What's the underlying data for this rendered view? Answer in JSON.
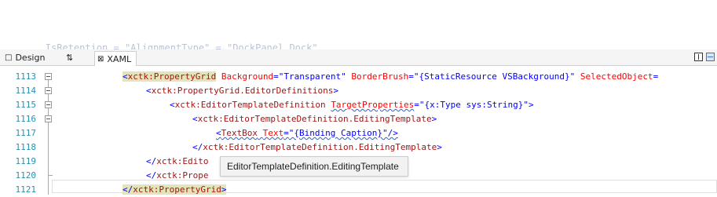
{
  "tabs": {
    "design": "Design",
    "swap_icon": "swap-panes-icon",
    "xaml": "XAML"
  },
  "editor": {
    "ghost_text": "        IsRetention = \"AlignmentType\" = \"DockPanel.Dock\"",
    "lines": [
      {
        "number": "1113"
      },
      {
        "number": "1114"
      },
      {
        "number": "1115"
      },
      {
        "number": "1116"
      },
      {
        "number": "1117"
      },
      {
        "number": "1118"
      },
      {
        "number": "1119"
      },
      {
        "number": "1120"
      },
      {
        "number": "1121"
      }
    ],
    "code": {
      "l1113": {
        "open": "<",
        "tag": "xctk:PropertyGrid",
        "a1": "Background",
        "v1": "\"Transparent\"",
        "a2": "BorderBrush",
        "v2": "\"{StaticResource VSBackground}\"",
        "a3": "SelectedObject",
        "eq": "="
      },
      "l1114": {
        "open": "<",
        "tag": "xctk:PropertyGrid.EditorDefinitions",
        "close": ">"
      },
      "l1115": {
        "open": "<",
        "tag": "xctk:EditorTemplateDefinition",
        "a1": "TargetProperties",
        "v1": "\"{x:Type sys:String}\"",
        "close": ">"
      },
      "l1116": {
        "open": "<",
        "tag": "xctk:EditorTemplateDefinition.EditingTemplate",
        "close": ">"
      },
      "l1117": {
        "open": "<",
        "tag": "TextBox",
        "a1": "Text",
        "v1": "\"{Binding Caption}\"",
        "close": "/>"
      },
      "l1118": {
        "open": "</",
        "tag": "xctk:EditorTemplateDefinition.EditingTemplate",
        "close": ">"
      },
      "l1119": {
        "open": "</",
        "tag": "xctk:Edito"
      },
      "l1120": {
        "open": "</",
        "tag": "xctk:Prope"
      },
      "l1121": {
        "open": "</",
        "tag": "xctk:PropertyGrid",
        "close": ">"
      }
    }
  },
  "tooltip": {
    "text": "EditorTemplateDefinition.EditingTemplate"
  }
}
